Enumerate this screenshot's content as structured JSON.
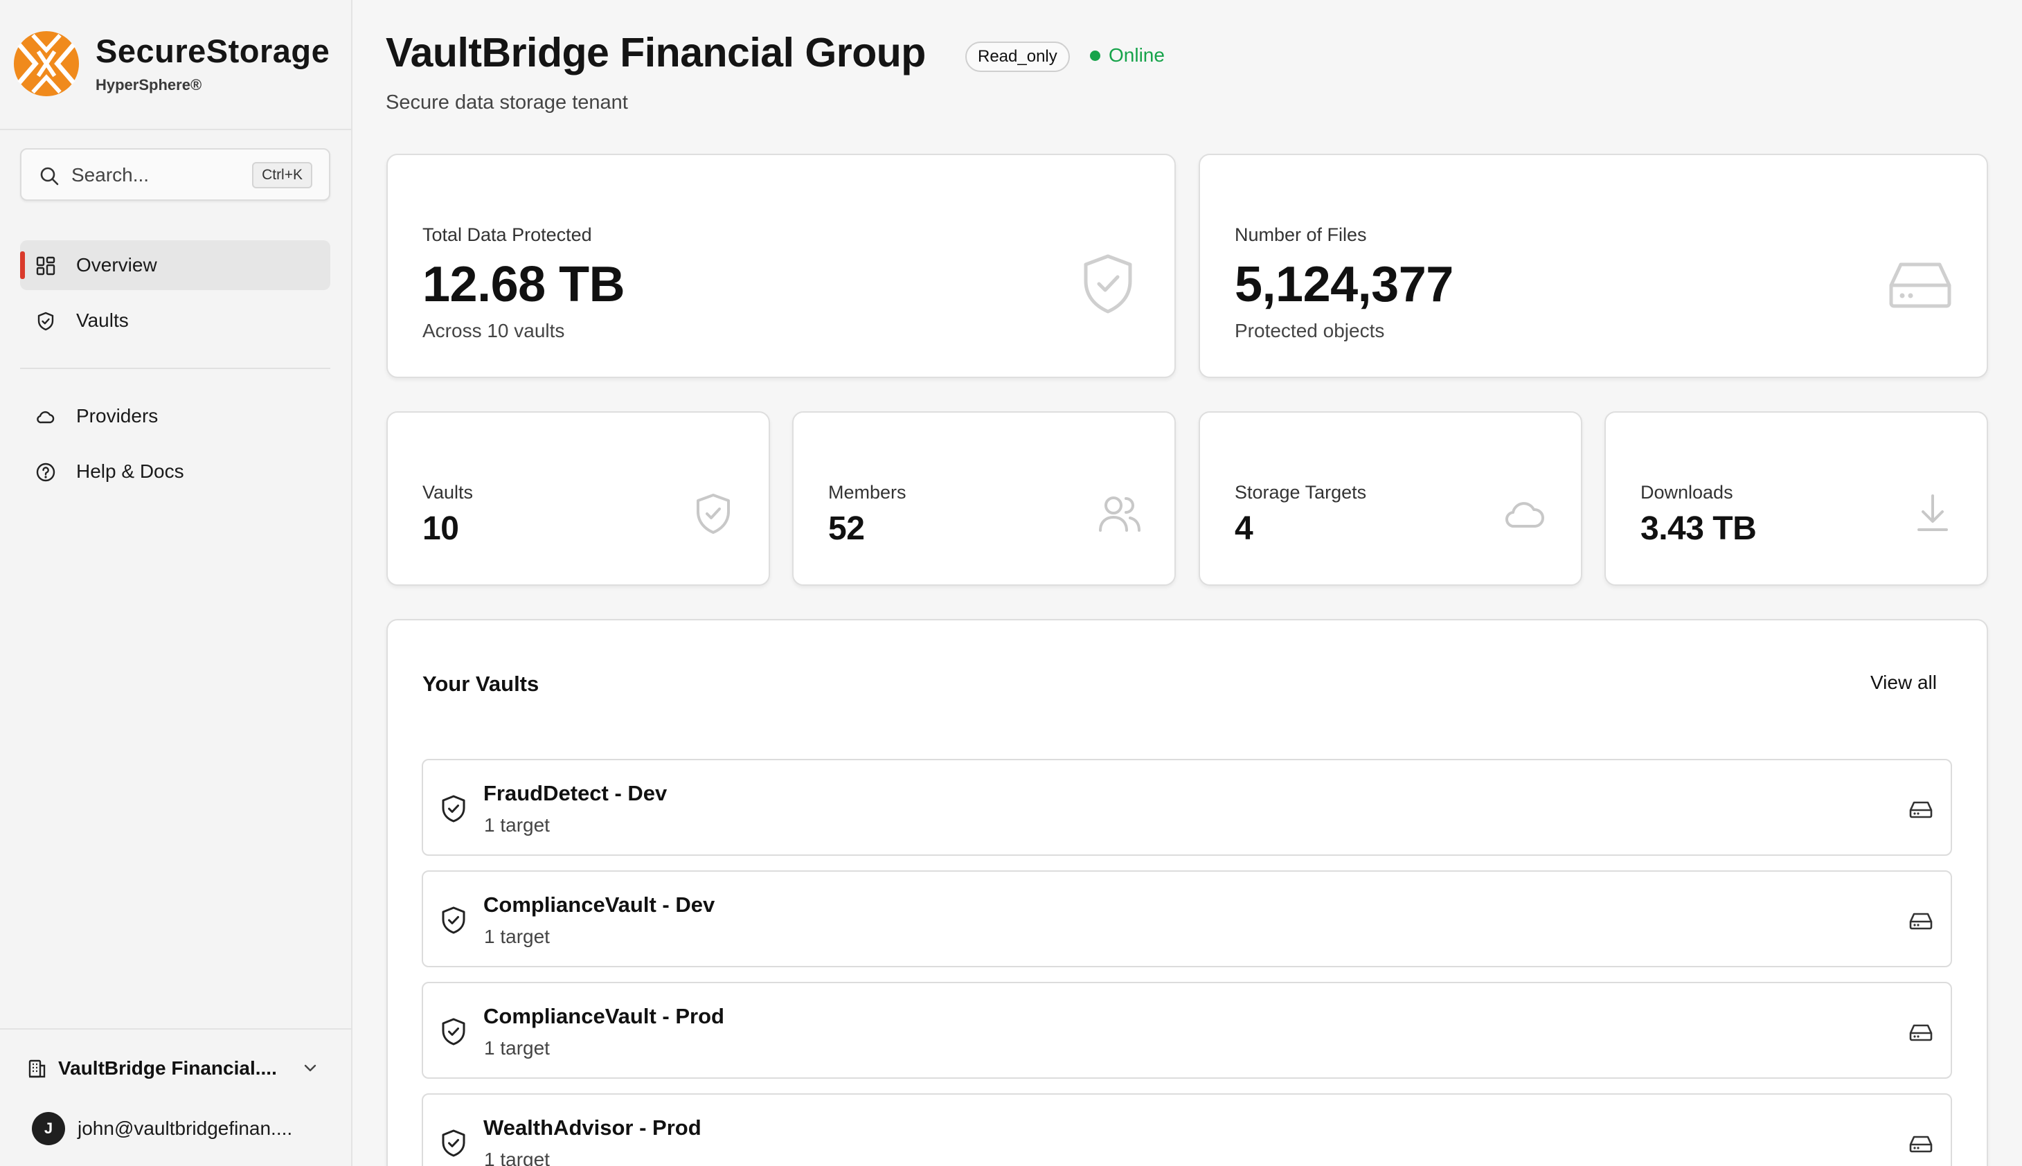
{
  "brand": {
    "name": "SecureStorage",
    "product": "HyperSphere®",
    "accent_color": "#f08a1c"
  },
  "search": {
    "placeholder": "Search...",
    "shortcut": "Ctrl+K"
  },
  "nav": {
    "items": [
      {
        "label": "Overview",
        "icon": "grid-icon",
        "active": true
      },
      {
        "label": "Vaults",
        "icon": "shield-icon",
        "active": false
      },
      {
        "label": "Providers",
        "icon": "cloud-icon",
        "active": false
      },
      {
        "label": "Help & Docs",
        "icon": "help-circle-icon",
        "active": false
      }
    ],
    "active_accent_color": "#d93a2b"
  },
  "footer": {
    "org_name": "VaultBridge Financial....",
    "user_initial": "J",
    "user_email": "john@vaultbridgefinan...."
  },
  "header": {
    "title": "VaultBridge Financial Group",
    "role_badge": "Read_only",
    "status": "Online",
    "status_color": "#16a34a",
    "subtitle": "Secure data storage tenant"
  },
  "stats": {
    "total_data": {
      "label": "Total Data Protected",
      "value": "12.68 TB",
      "sub": "Across 10 vaults",
      "icon": "shield-check-icon"
    },
    "files": {
      "label": "Number of Files",
      "value": "5,124,377",
      "sub": "Protected objects",
      "icon": "hard-drive-icon"
    },
    "vaults": {
      "label": "Vaults",
      "value": "10",
      "icon": "shield-check-icon"
    },
    "members": {
      "label": "Members",
      "value": "52",
      "icon": "users-icon"
    },
    "targets": {
      "label": "Storage Targets",
      "value": "4",
      "icon": "cloud-icon"
    },
    "downloads": {
      "label": "Downloads",
      "value": "3.43 TB",
      "icon": "download-icon"
    }
  },
  "vaults_panel": {
    "title": "Your Vaults",
    "view_all": "View all",
    "items": [
      {
        "name": "FraudDetect - Dev",
        "meta": "1 target"
      },
      {
        "name": "ComplianceVault - Dev",
        "meta": "1 target"
      },
      {
        "name": "ComplianceVault - Prod",
        "meta": "1 target"
      },
      {
        "name": "WealthAdvisor - Prod",
        "meta": "1 target"
      }
    ]
  }
}
